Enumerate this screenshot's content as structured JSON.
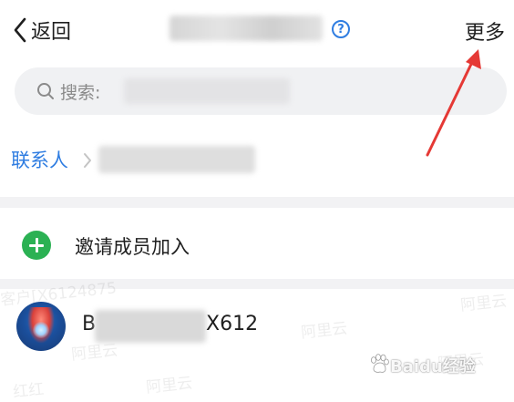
{
  "nav": {
    "back_label": "返回",
    "help_symbol": "?",
    "more_label": "更多"
  },
  "search": {
    "label": "搜索:"
  },
  "breadcrumb": {
    "root": "联系人"
  },
  "actions": {
    "invite_label": "邀请成员加入"
  },
  "member": {
    "name_prefix": "B",
    "name_suffix": "X612"
  },
  "watermarks": {
    "items": [
      "客户[X6124875",
      "阿里云",
      "阿里云",
      "阿里云",
      "阿里云",
      "阿里云",
      "红红"
    ]
  },
  "footer": {
    "baidu_watermark": "Baidu经验"
  },
  "colors": {
    "accent_blue": "#2f7de1",
    "invite_green": "#2bb153",
    "annotation_red": "#e53935",
    "search_bg": "#f0f1f3",
    "divider": "#f2f2f4"
  }
}
